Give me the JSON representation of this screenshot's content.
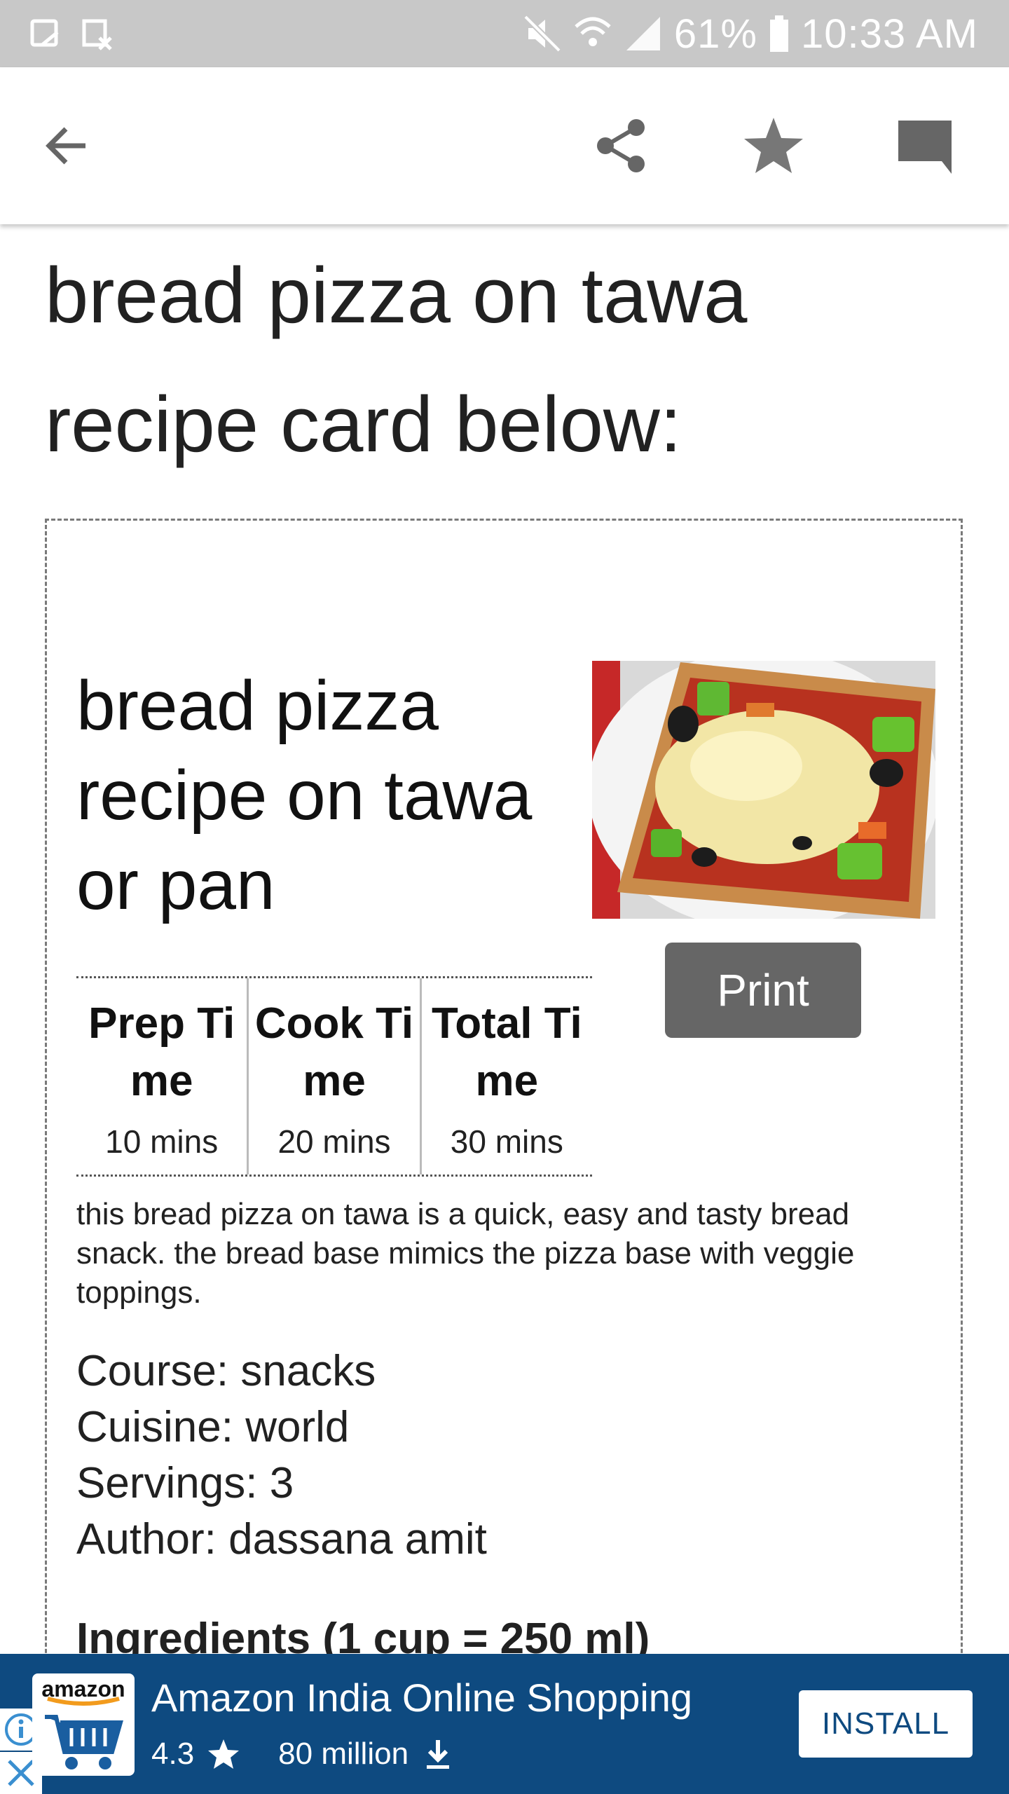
{
  "status_bar": {
    "battery": "61%",
    "time": "10:33 AM"
  },
  "app_bar": {
    "icons": [
      "back-arrow-icon",
      "share-icon",
      "star-icon",
      "comment-icon"
    ]
  },
  "article": {
    "heading": "bread pizza on tawa recipe card below:"
  },
  "recipe_card": {
    "title": "bread pizza recipe on tawa or pan",
    "print_label": "Print",
    "times": [
      {
        "label": "Prep Ti me",
        "value": "10 mins"
      },
      {
        "label": "Cook Ti me",
        "value": "20 mins"
      },
      {
        "label": "Total Ti me",
        "value": "30 mins"
      }
    ],
    "summary": "this bread pizza on tawa is a quick, easy and tasty bread snack. the bread base mimics the pizza base with veggie toppings.",
    "meta": [
      {
        "label": "Course:",
        "value": "snacks"
      },
      {
        "label": "Cuisine:",
        "value": "world"
      },
      {
        "label": "Servings:",
        "value": "3"
      },
      {
        "label": "Author:",
        "value": "dassana amit"
      }
    ],
    "ingredients_heading": "Ingredients (1 cup = 250 ml)"
  },
  "ad": {
    "brand": "amazon",
    "title": "Amazon India Online Shopping",
    "rating": "4.3",
    "downloads": "80 million",
    "install_label": "INSTALL"
  },
  "colors": {
    "status_bar": "#c8c8c8",
    "ad_background": "#0e4a80",
    "print_button": "#666666"
  }
}
